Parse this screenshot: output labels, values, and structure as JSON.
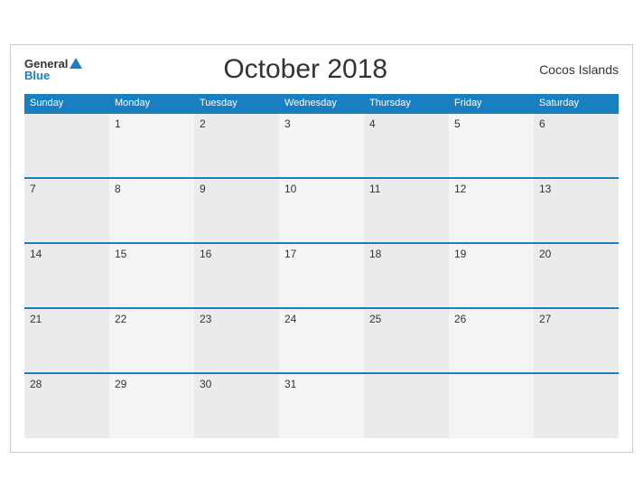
{
  "header": {
    "logo_general": "General",
    "logo_blue": "Blue",
    "title": "October 2018",
    "region": "Cocos Islands"
  },
  "days": [
    "Sunday",
    "Monday",
    "Tuesday",
    "Wednesday",
    "Thursday",
    "Friday",
    "Saturday"
  ],
  "weeks": [
    [
      "",
      "1",
      "2",
      "3",
      "4",
      "5",
      "6"
    ],
    [
      "7",
      "8",
      "9",
      "10",
      "11",
      "12",
      "13"
    ],
    [
      "14",
      "15",
      "16",
      "17",
      "18",
      "19",
      "20"
    ],
    [
      "21",
      "22",
      "23",
      "24",
      "25",
      "26",
      "27"
    ],
    [
      "28",
      "29",
      "30",
      "31",
      "",
      "",
      ""
    ]
  ]
}
